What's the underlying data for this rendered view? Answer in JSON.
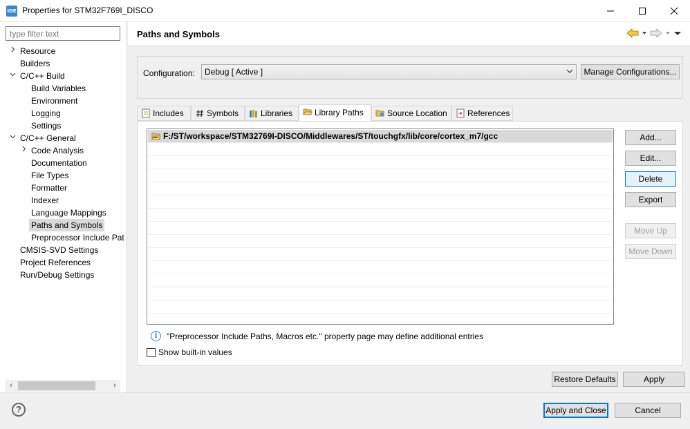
{
  "window": {
    "app_icon_text": "IDE",
    "title": "Properties for STM32F769I_DISCO"
  },
  "sidebar": {
    "filter_placeholder": "type filter text",
    "items": [
      {
        "label": "Resource",
        "level": 0,
        "twisty": "collapsed"
      },
      {
        "label": "Builders",
        "level": 0,
        "twisty": "none"
      },
      {
        "label": "C/C++ Build",
        "level": 0,
        "twisty": "expanded"
      },
      {
        "label": "Build Variables",
        "level": 1,
        "twisty": "none"
      },
      {
        "label": "Environment",
        "level": 1,
        "twisty": "none"
      },
      {
        "label": "Logging",
        "level": 1,
        "twisty": "none"
      },
      {
        "label": "Settings",
        "level": 1,
        "twisty": "none"
      },
      {
        "label": "C/C++ General",
        "level": 0,
        "twisty": "expanded"
      },
      {
        "label": "Code Analysis",
        "level": 1,
        "twisty": "collapsed"
      },
      {
        "label": "Documentation",
        "level": 1,
        "twisty": "none"
      },
      {
        "label": "File Types",
        "level": 1,
        "twisty": "none"
      },
      {
        "label": "Formatter",
        "level": 1,
        "twisty": "none"
      },
      {
        "label": "Indexer",
        "level": 1,
        "twisty": "none"
      },
      {
        "label": "Language Mappings",
        "level": 1,
        "twisty": "none"
      },
      {
        "label": "Paths and Symbols",
        "level": 1,
        "twisty": "none",
        "selected": true
      },
      {
        "label": "Preprocessor Include Pat",
        "level": 1,
        "twisty": "none"
      },
      {
        "label": "CMSIS-SVD Settings",
        "level": 0,
        "twisty": "none"
      },
      {
        "label": "Project References",
        "level": 0,
        "twisty": "none"
      },
      {
        "label": "Run/Debug Settings",
        "level": 0,
        "twisty": "none"
      }
    ]
  },
  "page": {
    "title": "Paths and Symbols",
    "configuration_label": "Configuration:",
    "configuration_value": "Debug  [ Active ]",
    "manage_button": "Manage Configurations...",
    "tabs": [
      {
        "label": "Includes",
        "icon": "includes-icon"
      },
      {
        "label": "Symbols",
        "icon": "hash-icon"
      },
      {
        "label": "Libraries",
        "icon": "libraries-icon"
      },
      {
        "label": "Library Paths",
        "icon": "folder-open-icon",
        "active": true
      },
      {
        "label": "Source Location",
        "icon": "source-folder-icon"
      },
      {
        "label": "References",
        "icon": "references-icon"
      }
    ],
    "library_paths": [
      "F:/ST/workspace/STM32769I-DISCO/Middlewares/ST/touchgfx/lib/core/cortex_m7/gcc"
    ],
    "side_buttons": {
      "add": "Add...",
      "edit": "Edit...",
      "delete": "Delete",
      "export": "Export",
      "move_up": "Move Up",
      "move_down": "Move Down"
    },
    "info_text": "\"Preprocessor Include Paths, Macros etc.\" property page may define additional entries",
    "show_builtin_label": "Show built-in values",
    "show_builtin_checked": false,
    "restore_defaults": "Restore Defaults",
    "apply": "Apply"
  },
  "footer": {
    "apply_and_close": "Apply and Close",
    "cancel": "Cancel",
    "help_glyph": "?"
  },
  "colors": {
    "accent": "#0078d7",
    "selection": "#d9d9d9"
  }
}
